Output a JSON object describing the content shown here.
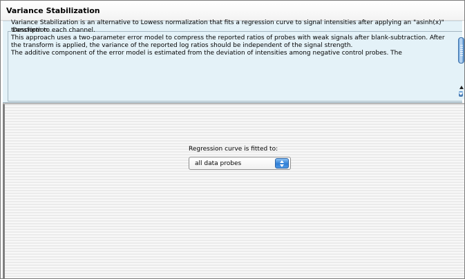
{
  "window": {
    "title": "Variance Stabilization"
  },
  "description": {
    "legend": "Description",
    "paragraphs": [
      "Variance Stabilization is an alternative to Lowess normalization that fits a regression curve to signal intensities after applying an \"asinh(x)\" transform to each channel.",
      " This approach uses a two-parameter error model to compress the reported ratios of probes with weak signals after blank-subtraction. After the transform is applied, the variance of the reported log ratios should be independent of the signal strength.",
      " The additive component of the error model is estimated from the deviation of intensities among negative control probes. The"
    ]
  },
  "regression": {
    "label": "Regression curve is fitted to:",
    "selected": "all data probes"
  },
  "colors": {
    "description_background": "#e4f2f8",
    "accent_blue": "#2f7fd6"
  }
}
